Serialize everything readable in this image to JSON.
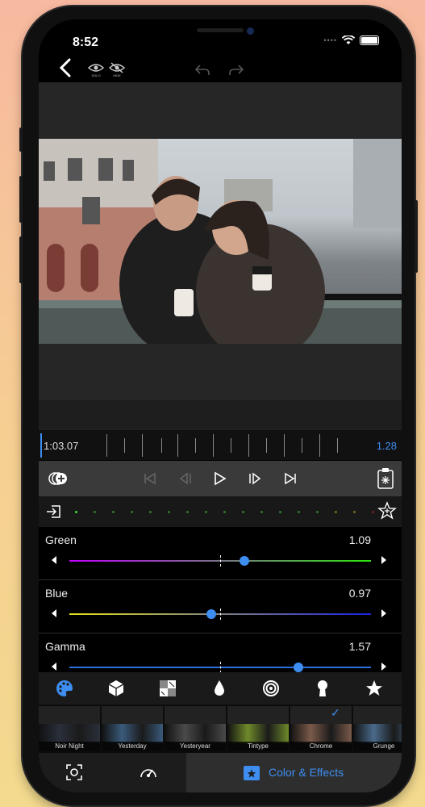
{
  "status": {
    "time": "8:52"
  },
  "topbar": {
    "eye_labels": [
      "SOLO",
      "HIDE"
    ]
  },
  "timeline": {
    "timecode": "1:03.07",
    "zoom": "1.28"
  },
  "sliders": [
    {
      "label": "Green",
      "value": "1.09",
      "position": 0.58,
      "gradient": [
        "#c400ff",
        "#2ee60e"
      ]
    },
    {
      "label": "Blue",
      "value": "0.97",
      "position": 0.47,
      "gradient": [
        "#e5e01a",
        "#1a22e5"
      ]
    },
    {
      "label": "Gamma",
      "value": "1.57",
      "position": 0.76,
      "gradient": [
        "#2a6fdd",
        "#2a6fdd"
      ]
    }
  ],
  "categories": [
    "palette-icon",
    "cube-icon",
    "texture-icon",
    "drop-icon",
    "spiral-icon",
    "keyhole-icon",
    "star-icon"
  ],
  "presets": [
    {
      "label": "Noir Night",
      "tint": "#2a2f3a"
    },
    {
      "label": "Yesterday",
      "tint": "#3a5a7a"
    },
    {
      "label": "Yesteryear",
      "tint": "#4a4a4a"
    },
    {
      "label": "Tintype",
      "tint": "#6e8a2a"
    },
    {
      "label": "Chrome",
      "tint": "#7a5a4a",
      "selected": true
    },
    {
      "label": "Grunge",
      "tint": "#4a6a8a"
    }
  ],
  "bottombar": {
    "active_label": "Color & Effects"
  },
  "colors": {
    "accent": "#3d8ef0"
  }
}
